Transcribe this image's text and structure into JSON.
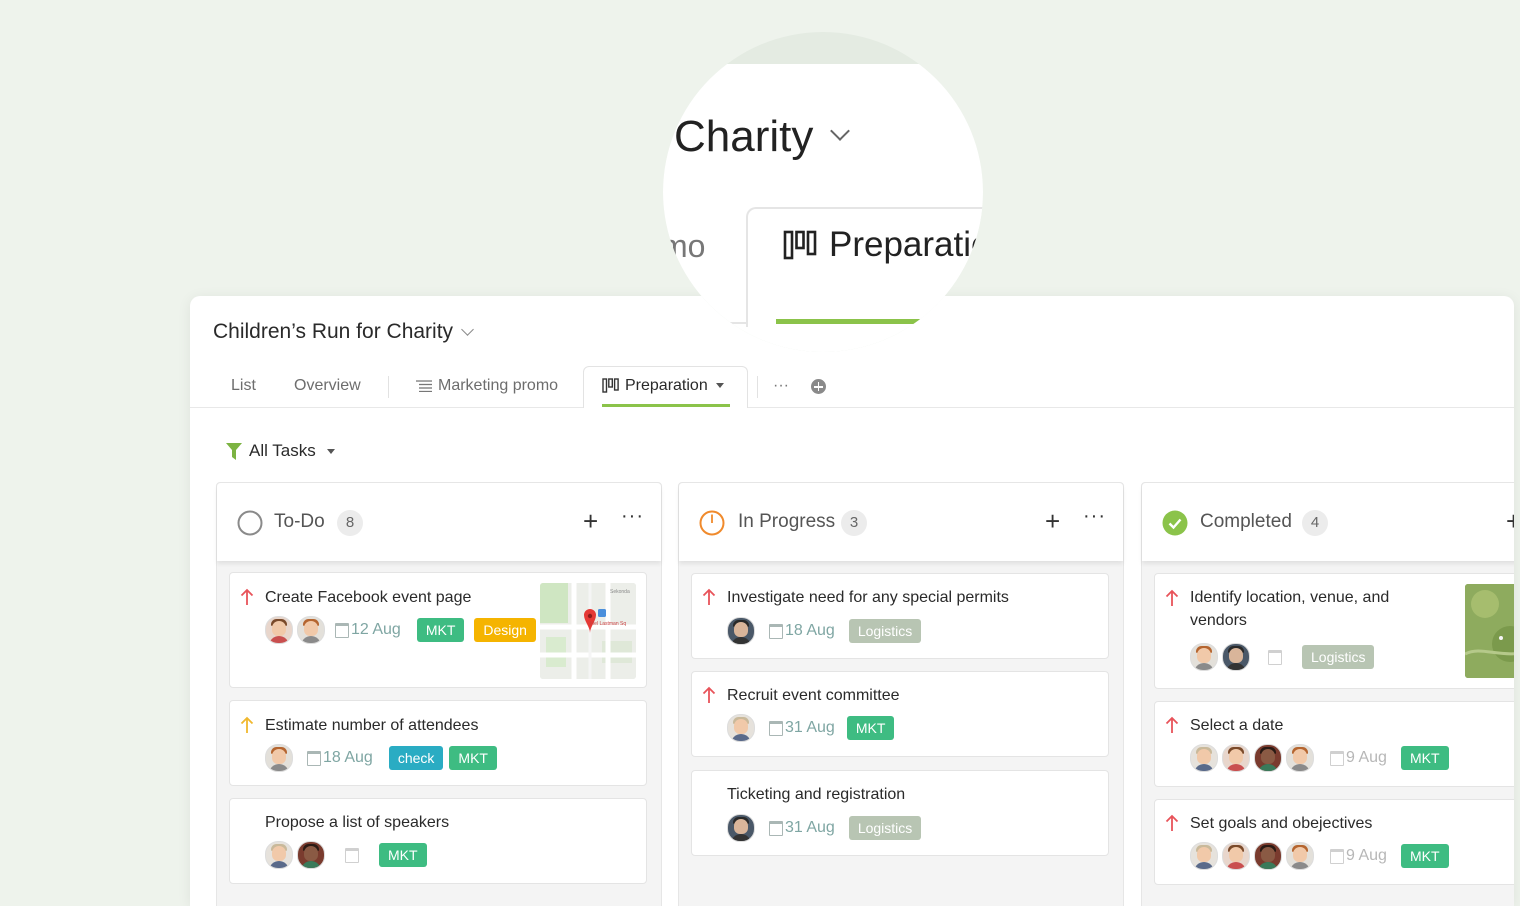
{
  "magnifier": {
    "title": "Charity",
    "left_tab": "mo",
    "active_tab": "Preparatic"
  },
  "project": {
    "title": "Children’s Run for Charity"
  },
  "tabs": [
    {
      "label": "List"
    },
    {
      "label": "Overview"
    },
    {
      "label": "Marketing promo"
    },
    {
      "label": "Preparation"
    }
  ],
  "tabs_more": "···",
  "filter": {
    "label": "All Tasks"
  },
  "columns": [
    {
      "title": "To-Do",
      "count": "8",
      "tasks": [
        {
          "title": "Create Facebook event page",
          "date": "12 Aug",
          "tags": [
            "MKT",
            "Design"
          ],
          "priority": "high"
        },
        {
          "title": "Estimate number of attendees",
          "date": "18 Aug",
          "tags": [
            "check",
            "MKT"
          ],
          "priority": "medium"
        },
        {
          "title": "Propose a list of speakers",
          "date": "",
          "tags": [
            "MKT"
          ],
          "priority": "none"
        }
      ]
    },
    {
      "title": "In Progress",
      "count": "3",
      "tasks": [
        {
          "title": "Investigate need for any special permits",
          "date": "18 Aug",
          "tags": [
            "Logistics"
          ],
          "priority": "high"
        },
        {
          "title": "Recruit event committee",
          "date": "31 Aug",
          "tags": [
            "MKT"
          ],
          "priority": "high"
        },
        {
          "title": "Ticketing and registration",
          "date": "31 Aug",
          "tags": [
            "Logistics"
          ],
          "priority": "none"
        }
      ]
    },
    {
      "title": "Completed",
      "count": "4",
      "tasks": [
        {
          "title_line1": "Identify location, venue, and",
          "title_line2": "vendors",
          "date": "",
          "tags": [
            "Logistics"
          ],
          "priority": "high"
        },
        {
          "title": "Select a date",
          "date": "9 Aug",
          "tags": [
            "MKT"
          ],
          "priority": "high"
        },
        {
          "title": "Set goals and obejectives",
          "date": "9 Aug",
          "tags": [
            "MKT"
          ],
          "priority": "high"
        }
      ]
    }
  ],
  "map_labels": {
    "place": "Mel Lastman Sq",
    "street": "Sekonda"
  },
  "colors": {
    "accent_green": "#8bc34a",
    "tag_mkt": "#3ebc82",
    "tag_design": "#f5b400",
    "tag_check": "#2aacc3",
    "tag_logistics": "#b8c5b3",
    "priority_high": "#e8535a",
    "priority_medium": "#f0b82e",
    "in_progress": "#f08a2c",
    "completed": "#8bc34a"
  }
}
